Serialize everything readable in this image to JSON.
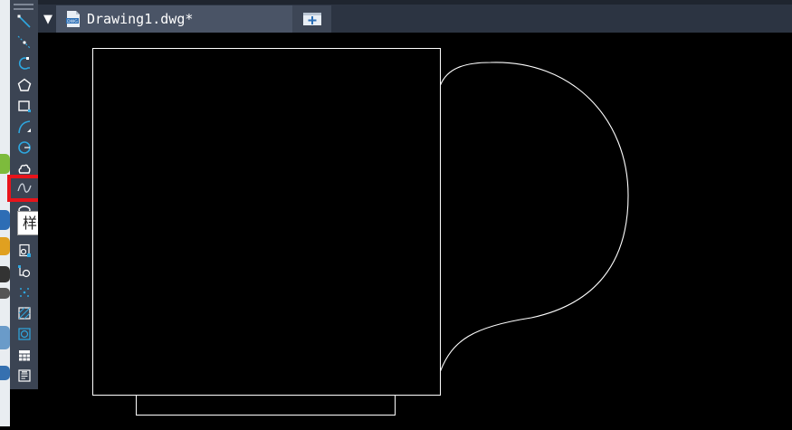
{
  "tab": {
    "title": "Drawing1.dwg*",
    "close_glyph": "✕",
    "menu_glyph": "▼",
    "file_icon": "dwg-file-icon",
    "new_tab_icon": "new-tab-icon"
  },
  "toolbar": {
    "tools": [
      {
        "name": "line",
        "icon": "line-icon"
      },
      {
        "name": "construction-line",
        "icon": "construction-line-icon"
      },
      {
        "name": "polyline",
        "icon": "polyline-icon"
      },
      {
        "name": "polygon",
        "icon": "polygon-icon"
      },
      {
        "name": "rectangle",
        "icon": "rectangle-icon"
      },
      {
        "name": "arc",
        "icon": "arc-icon"
      },
      {
        "name": "circle",
        "icon": "circle-icon"
      },
      {
        "name": "revision-cloud",
        "icon": "revision-cloud-icon"
      },
      {
        "name": "spline",
        "icon": "spline-icon",
        "highlighted": true
      },
      {
        "name": "ellipse",
        "icon": "ellipse-icon"
      },
      {
        "name": "insert-block",
        "icon": "insert-block-icon"
      },
      {
        "name": "make-block",
        "icon": "make-block-icon"
      },
      {
        "name": "point",
        "icon": "point-icon"
      },
      {
        "name": "hatch",
        "icon": "hatch-icon"
      },
      {
        "name": "region",
        "icon": "region-icon"
      },
      {
        "name": "table",
        "icon": "table-icon"
      },
      {
        "name": "multiline-text",
        "icon": "mtext-icon"
      }
    ],
    "highlight_color": "#e8141b"
  },
  "tooltip": {
    "text": "样条曲线"
  },
  "colors": {
    "canvas": "#000000",
    "toolbar": "#3b4453",
    "tab_active": "#4a5466",
    "icon_accent": "#2ea7e0"
  }
}
